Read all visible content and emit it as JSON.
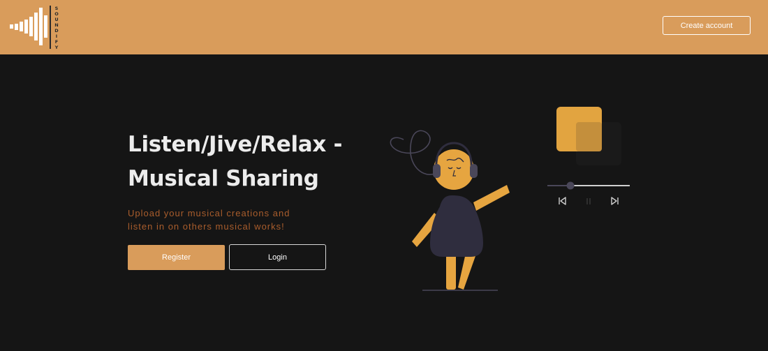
{
  "header": {
    "logo": {
      "wordmark": "SOUNDIFY",
      "icon": "soundwave-logo-icon"
    },
    "create_account_label": "Create account"
  },
  "hero": {
    "title_line1": "Listen/Jive/Relax -",
    "title_line2": "Musical Sharing",
    "subtitle_line1": "Upload your musical creations and",
    "subtitle_line2": "listen in on others musical works!",
    "register_label": "Register",
    "login_label": "Login"
  },
  "player": {
    "progress": 0.28,
    "controls": [
      "skip-back-icon",
      "pause-icon",
      "skip-forward-icon"
    ]
  },
  "colors": {
    "accent": "#d99c5b",
    "background": "#151515",
    "title": "#ececec",
    "subtitle": "#a95d2c",
    "figure_body": "#2f2d3e",
    "figure_skin": "#e6a540"
  }
}
